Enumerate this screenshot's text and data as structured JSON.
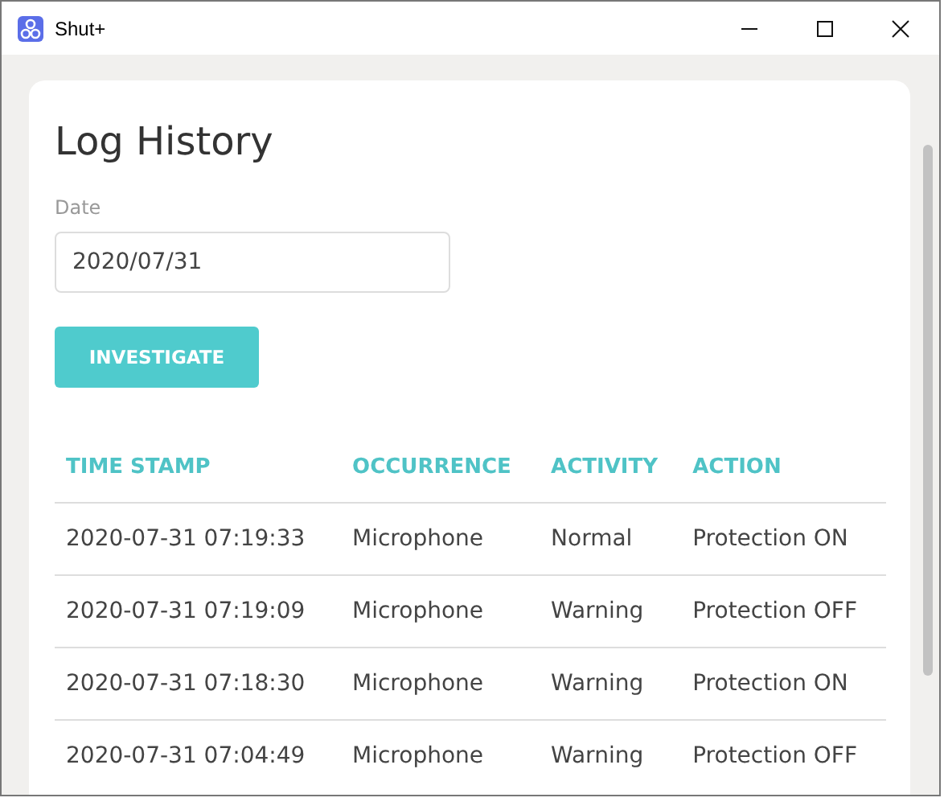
{
  "window": {
    "title": "Shut+"
  },
  "page_title": "Log History",
  "date_field": {
    "label": "Date",
    "value": "2020/07/31"
  },
  "button": "INVESTIGATE",
  "table": {
    "columns": [
      "TIME STAMP",
      "OCCURRENCE",
      "ACTIVITY",
      "ACTION"
    ],
    "rows": [
      [
        "2020-07-31 07:19:33",
        "Microphone",
        "Normal",
        "Protection ON"
      ],
      [
        "2020-07-31 07:19:09",
        "Microphone",
        "Warning",
        "Protection OFF"
      ],
      [
        "2020-07-31 07:18:30",
        "Microphone",
        "Warning",
        "Protection ON"
      ],
      [
        "2020-07-31 07:04:49",
        "Microphone",
        "Warning",
        "Protection OFF"
      ]
    ]
  }
}
